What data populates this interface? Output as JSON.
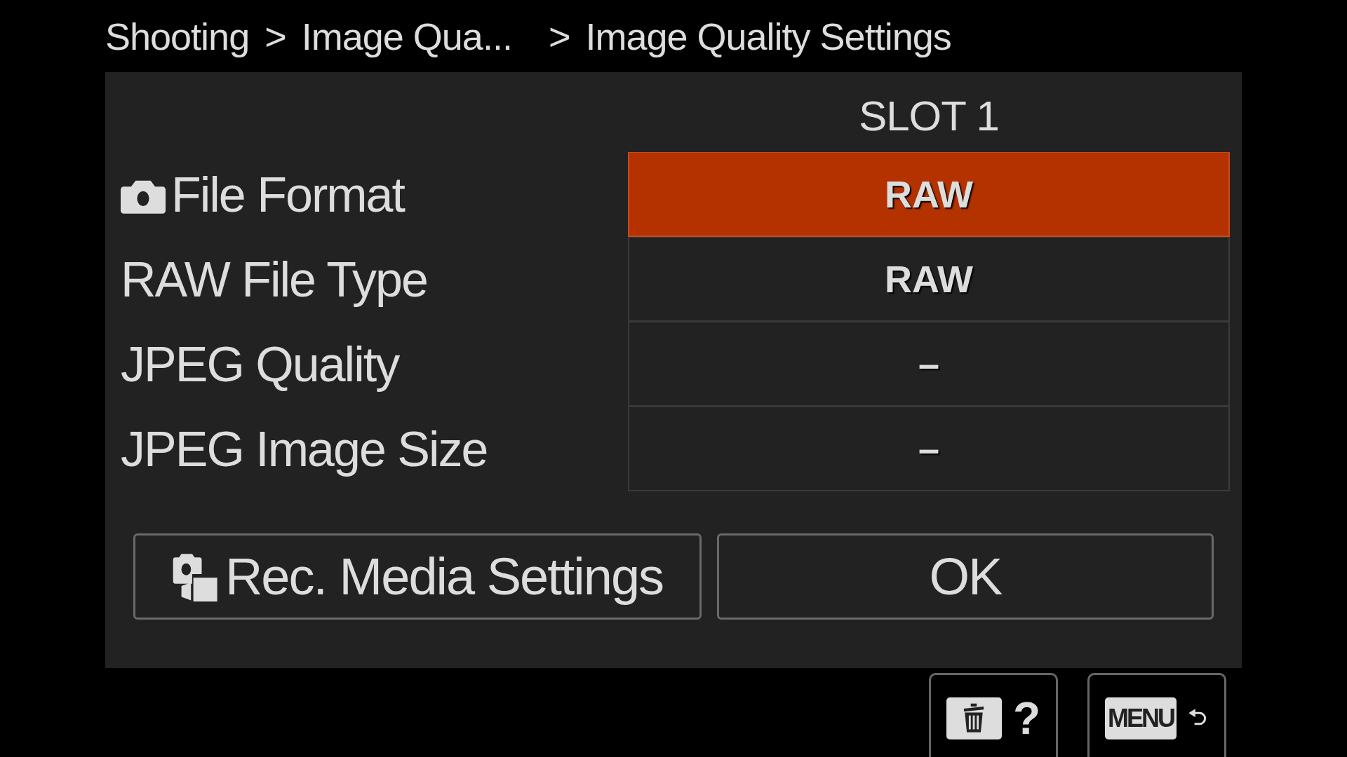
{
  "breadcrumb": [
    {
      "kind": "crumb",
      "text": "Shooting"
    },
    {
      "kind": "sep",
      "text": ">"
    },
    {
      "kind": "crumb",
      "text": "Image Qua..."
    },
    {
      "kind": "sep",
      "text": ">"
    },
    {
      "kind": "crumb",
      "text": "Image Quality Settings"
    }
  ],
  "panel": {
    "column_header": "SLOT 1",
    "rows": [
      {
        "kind": "camera",
        "label": "File Format",
        "value": "RAW",
        "selected": true
      },
      {
        "kind": "plain",
        "label": "RAW File Type",
        "value": "RAW",
        "selected": false
      },
      {
        "kind": "plain",
        "label": "JPEG Quality",
        "value": "–",
        "selected": false
      },
      {
        "kind": "plain",
        "label": "JPEG Image Size",
        "value": "–",
        "selected": false
      }
    ],
    "buttons": [
      {
        "kind": "media",
        "label": "Rec. Media Settings"
      },
      {
        "kind": "plain",
        "label": "OK"
      }
    ]
  },
  "footer_buttons": [
    {
      "kind": "delete-help",
      "text": "?"
    },
    {
      "kind": "menu-back",
      "text": "MENU"
    }
  ]
}
